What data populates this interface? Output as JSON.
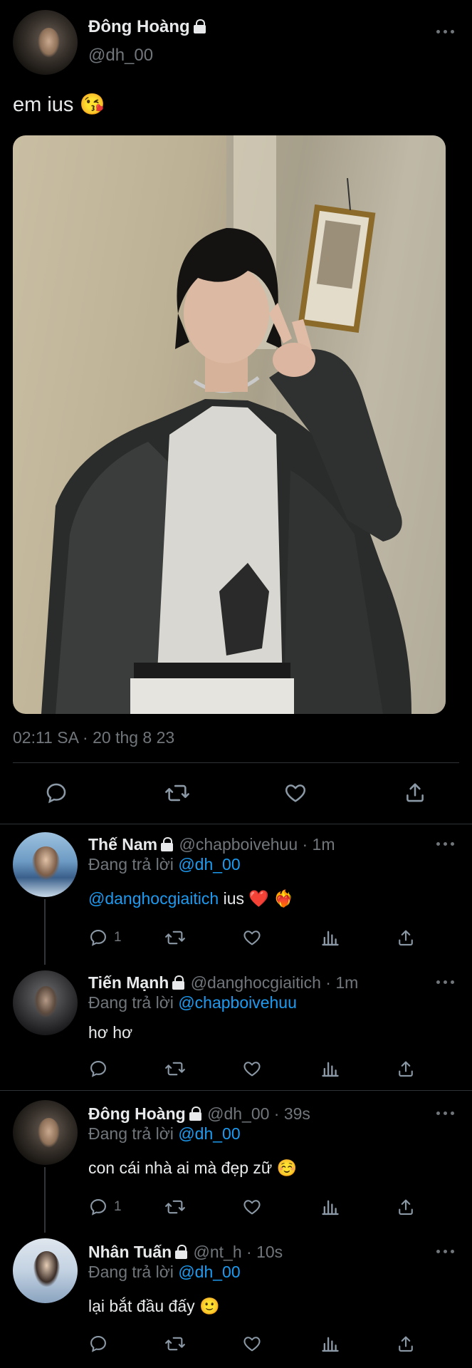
{
  "tweet": {
    "author_name": "Đông Hoàng",
    "author_handle": "@dh_00",
    "text": "em ius 😘",
    "timestamp": "02:11 SA · 20 thg 8 23"
  },
  "replies": [
    {
      "name": "Thế Nam",
      "handle_time": "@chapboivehuu · 1m",
      "replying_prefix": "Đang trả lời",
      "replying_to": "@dh_00",
      "mention": "@danghocgiaitich",
      "text": " ius ❤️ ❤️‍🔥",
      "reply_count": "1"
    },
    {
      "name": "Tiến Mạnh",
      "handle_time": "@danghocgiaitich · 1m",
      "replying_prefix": "Đang trả lời",
      "replying_to": "@chapboivehuu",
      "text": "hơ hơ"
    },
    {
      "name": "Đông Hoàng",
      "handle_time": "@dh_00 · 39s",
      "replying_prefix": "Đang trả lời",
      "replying_to": "@dh_00",
      "text": "con cái nhà ai mà đẹp zữ ☺️",
      "reply_count": "1"
    },
    {
      "name": "Nhân Tuấn",
      "handle_time": "@nt_h · 10s",
      "replying_prefix": "Đang trả lời",
      "replying_to": "@dh_00",
      "text": "lại bắt đầu đấy 🙂"
    }
  ],
  "colors": {
    "background": "#000000",
    "text": "#e7e9ea",
    "muted": "#71767b",
    "link": "#1d9bf0",
    "divider": "#2f3336"
  },
  "icons": [
    "lock-icon",
    "more-icon",
    "reply-icon",
    "retweet-icon",
    "like-icon",
    "share-icon",
    "views-icon"
  ]
}
